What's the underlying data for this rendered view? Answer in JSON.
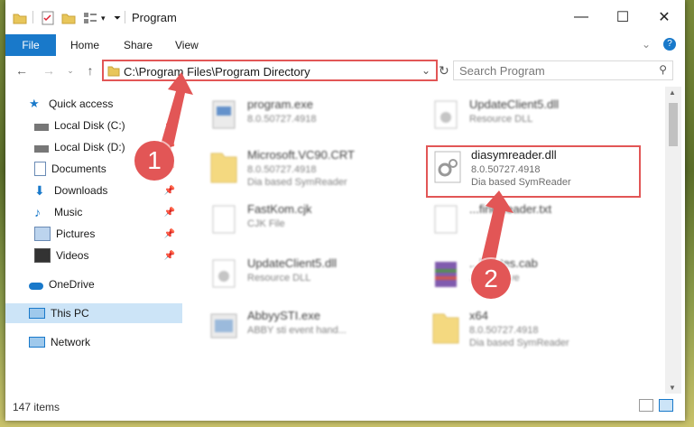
{
  "window": {
    "title": "Program",
    "controls": {
      "minimize": "—",
      "maximize": "☐",
      "close": "✕"
    }
  },
  "ribbon": {
    "file": "File",
    "tabs": [
      "Home",
      "Share",
      "View"
    ]
  },
  "address": {
    "path": "C:\\Program Files\\Program Directory"
  },
  "search": {
    "placeholder": "Search Program"
  },
  "sidebar": {
    "quick_access": "Quick access",
    "items": [
      {
        "label": "Local Disk (C:)",
        "icon": "drive-icon",
        "pinned": true
      },
      {
        "label": "Local Disk (D:)",
        "icon": "drive-icon",
        "pinned": true
      },
      {
        "label": "Documents",
        "icon": "documents-icon",
        "pinned": true
      },
      {
        "label": "Downloads",
        "icon": "downloads-icon",
        "pinned": true
      },
      {
        "label": "Music",
        "icon": "music-icon",
        "pinned": true
      },
      {
        "label": "Pictures",
        "icon": "pictures-icon",
        "pinned": true
      },
      {
        "label": "Videos",
        "icon": "videos-icon",
        "pinned": true
      }
    ],
    "onedrive": "OneDrive",
    "this_pc": "This PC",
    "network": "Network"
  },
  "files": [
    {
      "name": "program.exe",
      "sub": "8.0.50727.4918",
      "sub2": "",
      "icon": "exe-icon"
    },
    {
      "name": "UpdateClient5.dll",
      "sub": "Resource DLL",
      "sub2": "",
      "icon": "dll-icon"
    },
    {
      "name": "Microsoft.VC90.CRT",
      "sub": "8.0.50727.4918",
      "sub2": "Dia based SymReader",
      "icon": "folder-icon"
    },
    {
      "name": "diasymreader.dll",
      "sub": "8.0.50727.4918",
      "sub2": "Dia based SymReader",
      "icon": "dll-icon"
    },
    {
      "name": "FastKom.cjk",
      "sub": "CJK File",
      "sub2": "",
      "icon": "file-icon"
    },
    {
      "name": "...fineReader.txt",
      "sub": "",
      "sub2": "",
      "icon": "file-icon"
    },
    {
      "name": "UpdateClient5.dll",
      "sub": "Resource DLL",
      "sub2": "",
      "icon": "dll-icon"
    },
    {
      "name": "...ificates.cab",
      "sub": "...K Archive",
      "sub2": "",
      "icon": "archive-icon"
    },
    {
      "name": "AbbyySTI.exe",
      "sub": "ABBY sti event hand...",
      "sub2": "",
      "icon": "exe-icon"
    },
    {
      "name": "x64",
      "sub": "8.0.50727.4918",
      "sub2": "Dia based SymReader",
      "icon": "folder-icon"
    }
  ],
  "status": {
    "count": "147 items"
  },
  "callouts": [
    "1",
    "2"
  ],
  "colors": {
    "accent": "#1979ca",
    "highlight": "#e25656"
  }
}
